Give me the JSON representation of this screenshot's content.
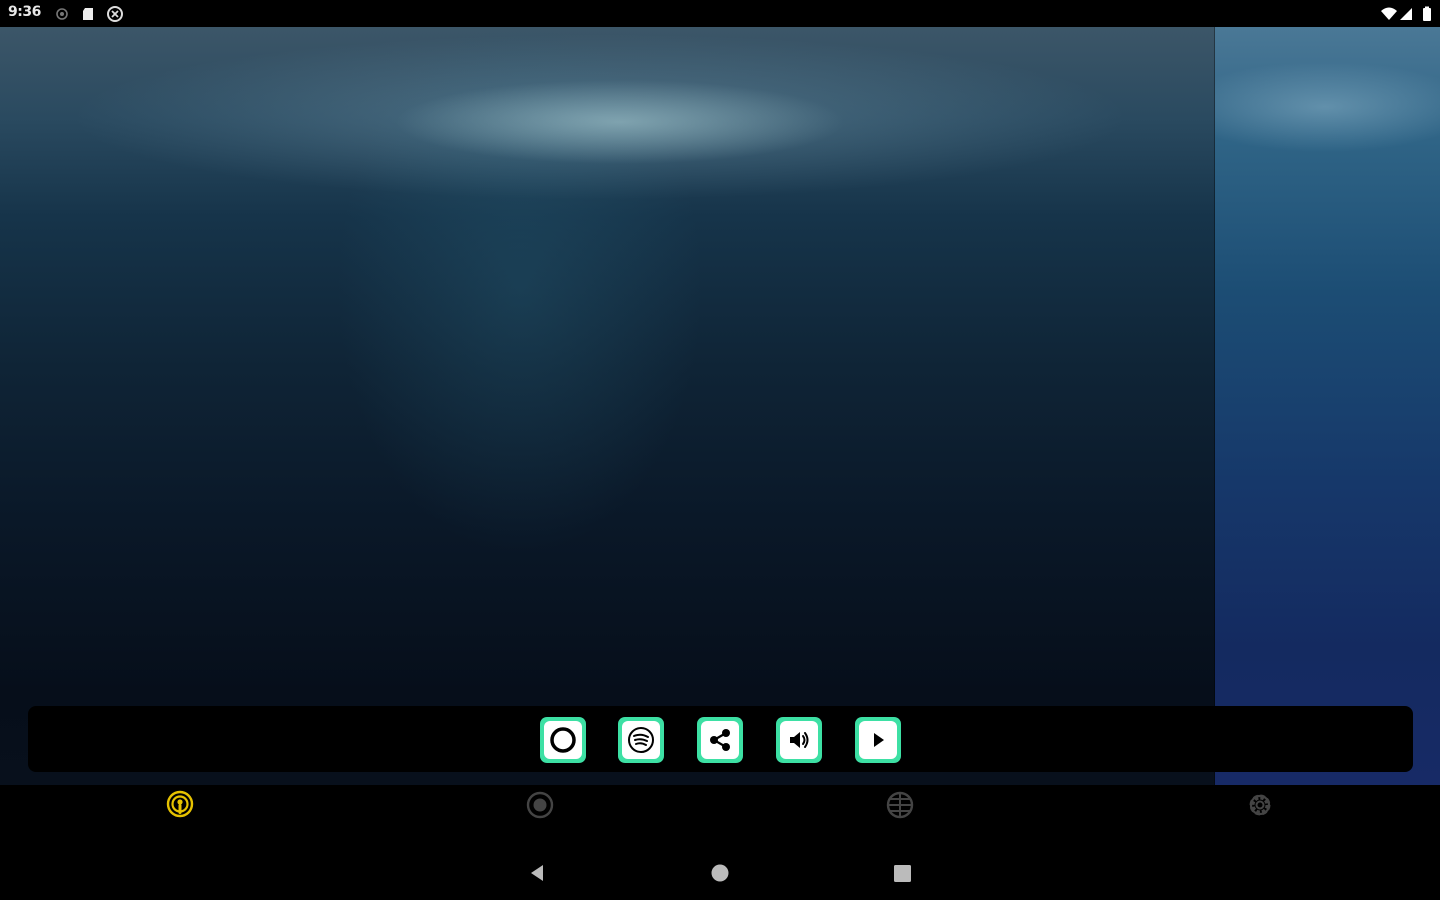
{
  "status_bar": {
    "time": "9:36",
    "left_icons": [
      "notification-dot-icon",
      "sd-card-icon",
      "vpn-icon"
    ],
    "right_icons": [
      "wifi-icon",
      "signal-icon",
      "battery-icon"
    ]
  },
  "dock": {
    "accent": "#3de0a4",
    "buttons": [
      {
        "name": "record-button",
        "icon": "circle-icon"
      },
      {
        "name": "spotify-button",
        "icon": "spotify-icon"
      },
      {
        "name": "share-button",
        "icon": "share-icon"
      },
      {
        "name": "volume-button",
        "icon": "volume-icon"
      },
      {
        "name": "play-button",
        "icon": "play-icon"
      }
    ]
  },
  "bottom_nav": {
    "active_color": "#e6c200",
    "inactive_color": "#444444",
    "items": [
      {
        "name": "podcast",
        "icon": "podcast-icon",
        "active": true
      },
      {
        "name": "record",
        "icon": "record-icon",
        "active": false
      },
      {
        "name": "globe",
        "icon": "globe-icon",
        "active": false
      },
      {
        "name": "settings",
        "icon": "gear-icon",
        "active": false
      }
    ]
  },
  "system_nav": [
    "back-icon",
    "home-icon",
    "recents-icon"
  ]
}
